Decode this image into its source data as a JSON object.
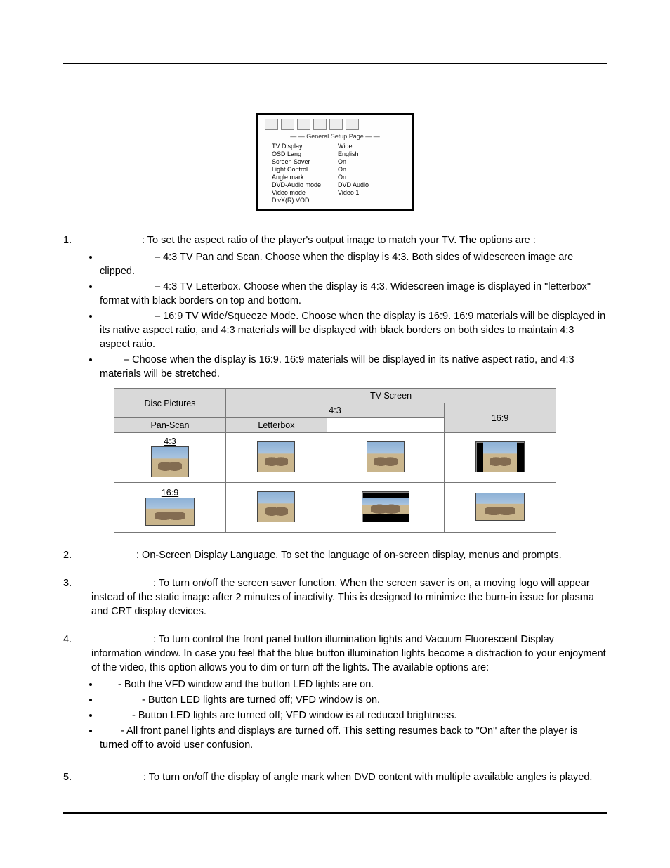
{
  "setup": {
    "title": "— — General Setup Page — —",
    "rows": [
      {
        "label": "TV Display",
        "value": "Wide"
      },
      {
        "label": "OSD Lang",
        "value": "English"
      },
      {
        "label": "Screen Saver",
        "value": "On"
      },
      {
        "label": "Light Control",
        "value": "On"
      },
      {
        "label": "Angle mark",
        "value": "On"
      },
      {
        "label": "DVD-Audio mode",
        "value": "DVD Audio"
      },
      {
        "label": "Video mode",
        "value": "Video 1"
      },
      {
        "label": "DivX(R) VOD",
        "value": ""
      }
    ]
  },
  "items": {
    "tvdisplay": {
      "num": "1.",
      "lead": ": To set the aspect ratio of the player's output image to match your TV.  The options are :",
      "opts": {
        "ps": "– 4:3 TV Pan and Scan.  Choose when the display is 4:3. Both sides of widescreen image are clipped.",
        "lb": "– 4:3 TV Letterbox.  Choose when the display is 4:3.  Widescreen image is displayed in \"letterbox\" format with black borders on top and bottom.",
        "sq": "– 16:9 TV Wide/Squeeze Mode.  Choose when the display is 16:9.  16:9 materials will be displayed in its native aspect ratio, and 4:3 materials will be displayed with black borders on both sides to maintain 4:3 aspect ratio.",
        "wide": "– Choose when the display is 16:9.  16:9 materials will be displayed in its native aspect ratio, and 4:3 materials will be stretched."
      }
    },
    "osd": {
      "num": "2.",
      "text": ": On-Screen Display Language.  To set the language of on-screen display, menus and prompts."
    },
    "saver": {
      "num": "3.",
      "text": ": To turn on/off the screen saver function.  When the screen saver is on, a moving logo will appear instead of the static image after 2 minutes of inactivity.  This is designed to minimize the burn-in issue for plasma and CRT display devices."
    },
    "light": {
      "num": "4.",
      "lead": ": To turn control the front panel button illumination lights and Vacuum Fluorescent Display information window.  In case you feel that the blue button illumination lights become a distraction to your enjoyment of the video, this option allows you to dim or turn off the lights.  The available options are:",
      "opts": {
        "a": "- Both the VFD window and the button LED lights are on.",
        "b": "- Button LED lights are turned off; VFD window is on.",
        "c": "- Button LED lights are turned off; VFD window is at reduced brightness.",
        "d": "- All front panel lights and displays are turned off. This setting resumes back to \"On\" after the player is turned off to avoid user confusion."
      }
    },
    "angle": {
      "num": "5.",
      "text": ": To turn on/off the display of angle mark when DVD content with multiple available angles is played."
    }
  },
  "table": {
    "disc_pictures": "Disc Pictures",
    "tv_screen": "TV Screen",
    "h43": "4:3",
    "h169": "16:9",
    "panscan": "Pan-Scan",
    "letterbox": "Letterbox",
    "row43": "4:3",
    "row169": "16:9"
  }
}
